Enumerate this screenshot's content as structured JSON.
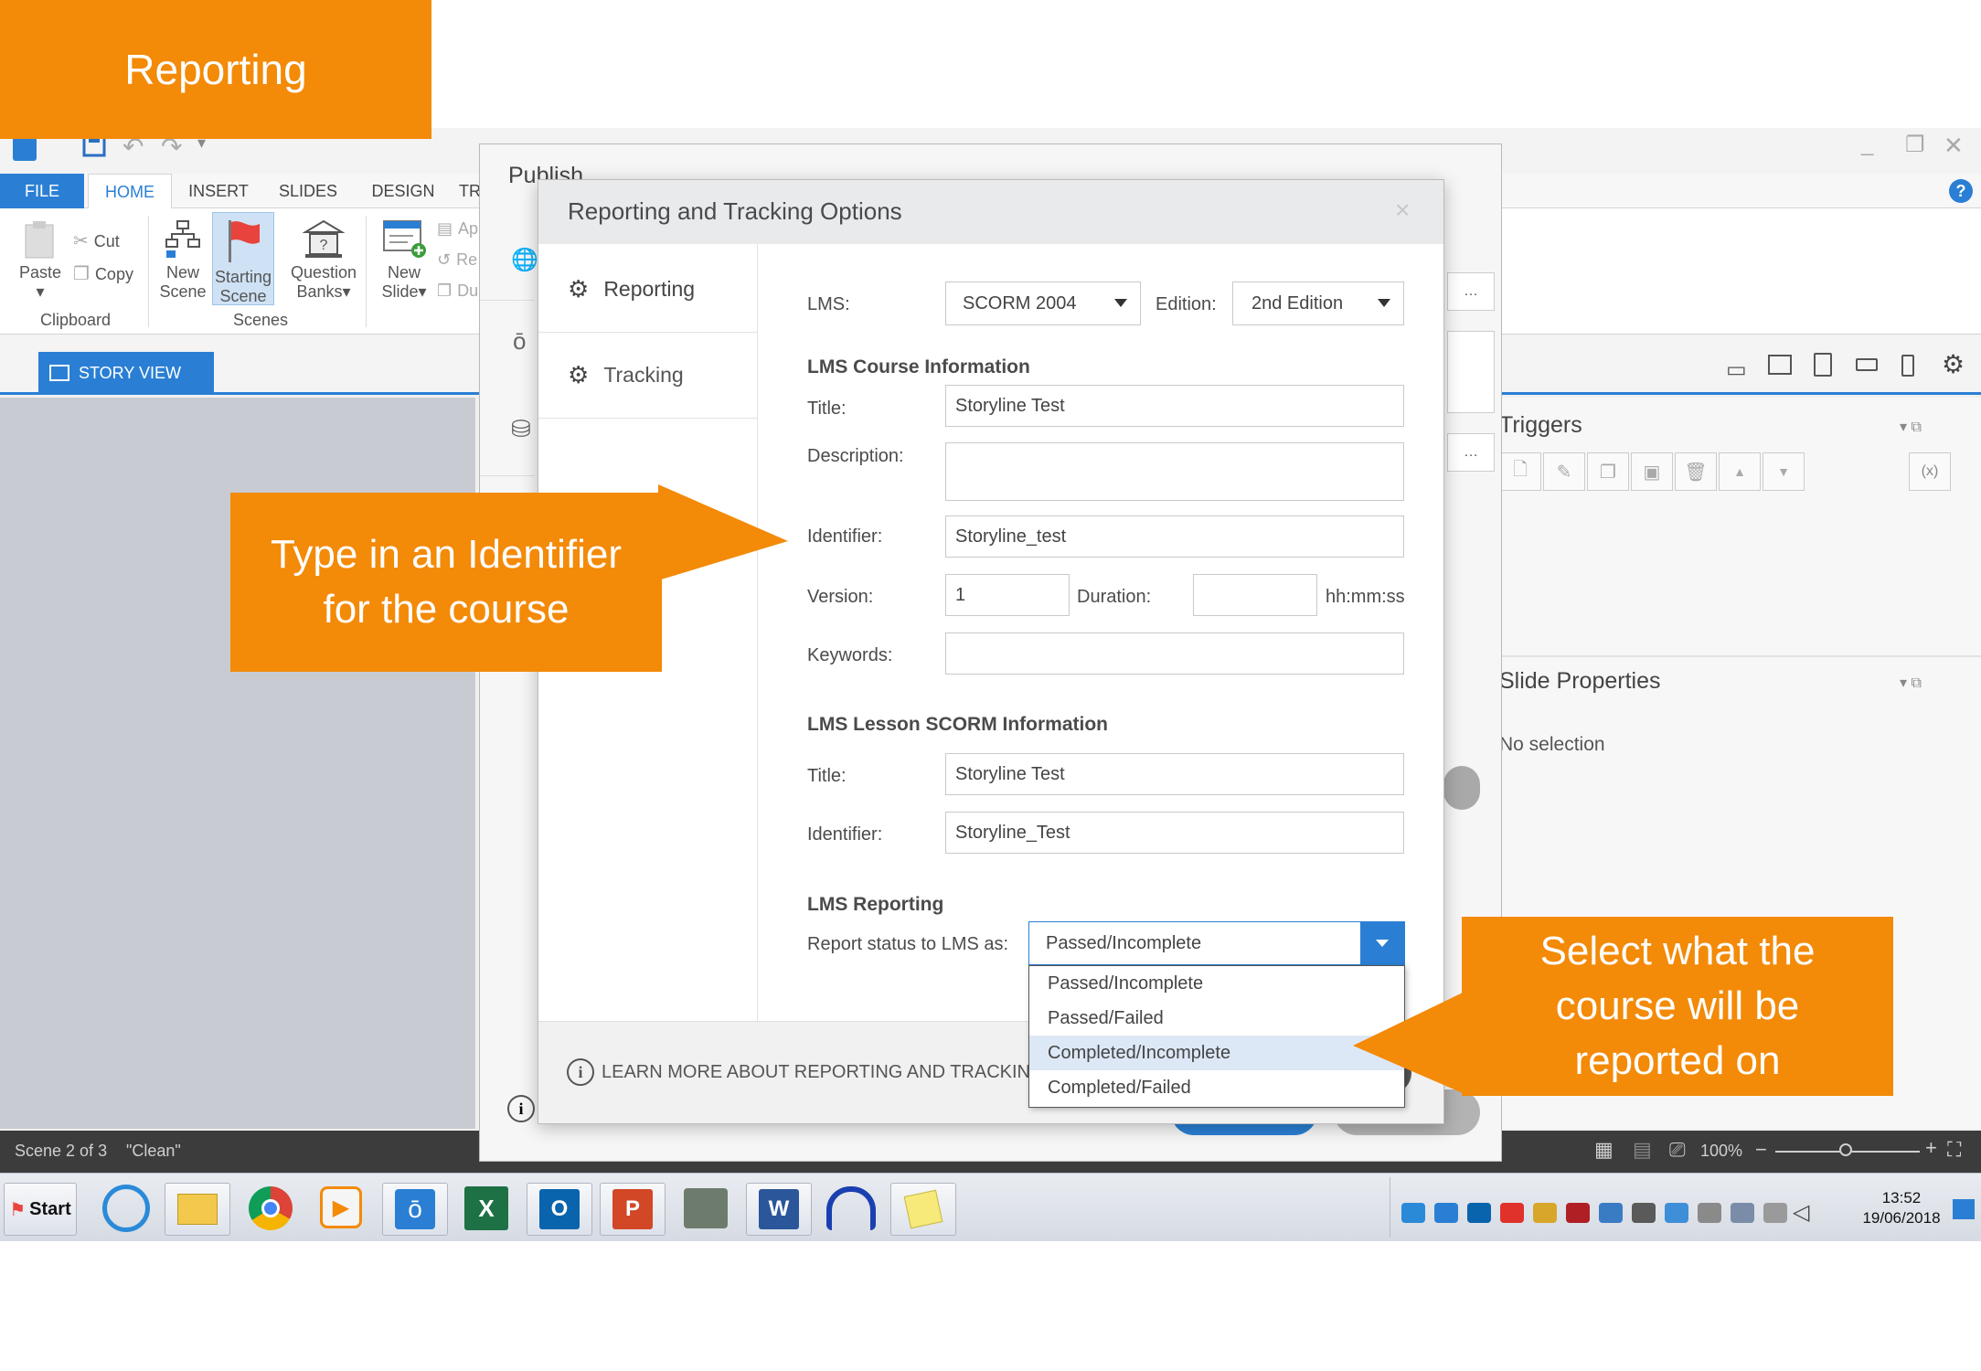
{
  "banner": {
    "title": "Reporting"
  },
  "ribbon": {
    "tabs": [
      "FILE",
      "HOME",
      "INSERT",
      "SLIDES",
      "DESIGN",
      "TR"
    ],
    "buttons": {
      "paste": "Paste",
      "cut": "Cut",
      "copy": "Copy",
      "new_scene_1": "New",
      "new_scene_2": "Scene",
      "starting_scene_1": "Starting",
      "starting_scene_2": "Scene",
      "question_banks_1": "Question",
      "question_banks_2": "Banks",
      "new_slide_1": "New",
      "new_slide_2": "Slide",
      "ap": "Ap",
      "re": "Re",
      "du": "Du"
    },
    "groups": {
      "clipboard": "Clipboard",
      "scenes": "Scenes"
    }
  },
  "view": {
    "story_view": "STORY VIEW"
  },
  "panels": {
    "triggers": "Triggers",
    "slide_properties": "Slide Properties",
    "no_selection": "No selection"
  },
  "status": {
    "scene": "Scene 2 of 3",
    "theme": "\"Clean\"",
    "zoom": "100%"
  },
  "publish": {
    "title": "Publish"
  },
  "options": {
    "title": "Reporting and Tracking Options",
    "close": "×",
    "nav": {
      "reporting": "Reporting",
      "tracking": "Tracking"
    },
    "lms_label": "LMS:",
    "lms_value": "SCORM 2004",
    "edition_label": "Edition:",
    "edition_value": "2nd Edition",
    "course_section": "LMS Course Information",
    "course_title_label": "Title:",
    "course_title_value": "Storyline Test",
    "description_label": "Description:",
    "description_value": "",
    "identifier_label": "Identifier:",
    "identifier_value": "Storyline_test",
    "version_label": "Version:",
    "version_value": "1",
    "duration_label": "Duration:",
    "duration_value": "",
    "duration_unit": "hh:mm:ss",
    "keywords_label": "Keywords:",
    "keywords_value": "",
    "lesson_section": "LMS Lesson SCORM Information",
    "lesson_title_label": "Title:",
    "lesson_title_value": "Storyline Test",
    "lesson_identifier_label": "Identifier:",
    "lesson_identifier_value": "Storyline_Test",
    "reporting_section": "LMS Reporting",
    "report_status_label": "Report status to LMS as:",
    "report_status_value": "Passed/Incomplete",
    "report_options": [
      "Passed/Incomplete",
      "Passed/Failed",
      "Completed/Incomplete",
      "Completed/Failed"
    ],
    "learn_more": "LEARN MORE ABOUT REPORTING AND TRACKING"
  },
  "callouts": {
    "identifier_1": "Type in an Identifier",
    "identifier_2": "for the course",
    "select_1": "Select what the",
    "select_2": "course will be",
    "select_3": "reported on"
  },
  "taskbar": {
    "start": "Start",
    "time": "13:52",
    "date": "19/06/2018"
  },
  "colors": {
    "accent": "#f38a08",
    "blue": "#2a7fd4"
  }
}
